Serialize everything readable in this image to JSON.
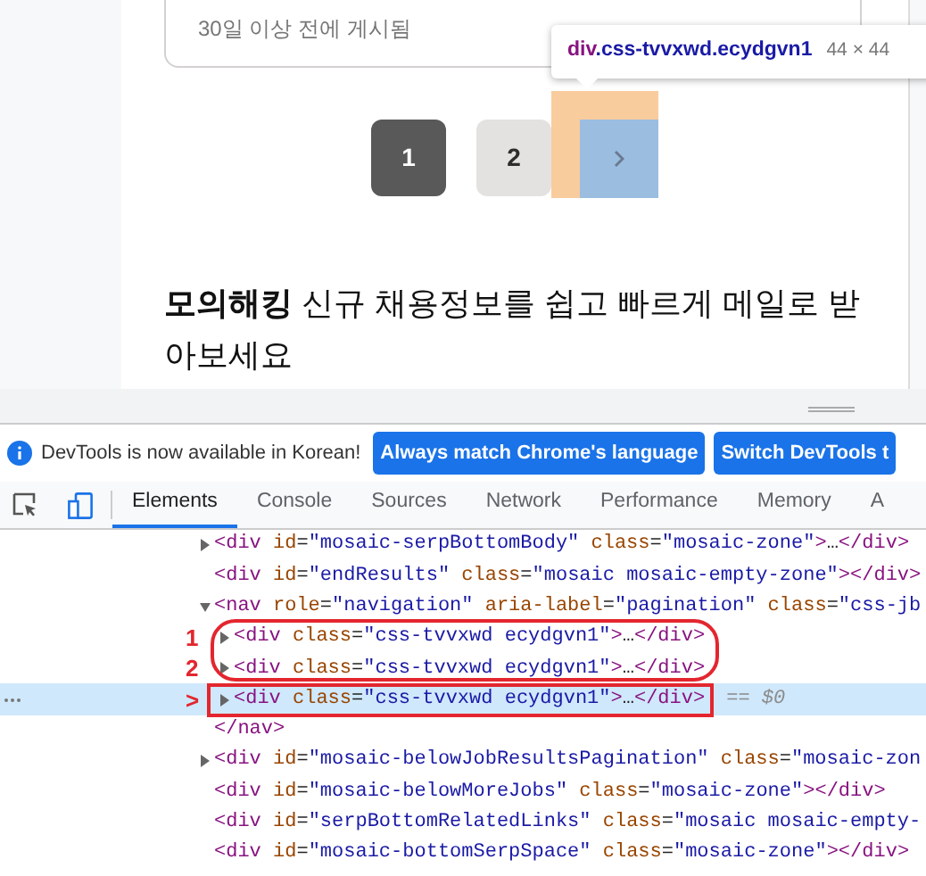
{
  "page": {
    "job_card": {
      "posted": "30일 이상 전에 게시됨"
    },
    "pagination": {
      "pages": [
        {
          "label": "1",
          "selected": true
        },
        {
          "label": "2",
          "selected": false
        }
      ],
      "next_inspected": true
    },
    "inspect_tooltip": {
      "element": "div",
      "classes": ".css-tvvxwd.ecydgvn1",
      "size": "44 × 44"
    },
    "alert_heading": "**모의해킹** 신규 채용정보를 쉽고 빠르게 메일로 받아보세요"
  },
  "devtools": {
    "infobar": {
      "message": "DevTools is now available in Korean!",
      "buttons": [
        "Always match Chrome's language",
        "Switch DevTools t"
      ]
    },
    "tabs": [
      {
        "label": "Elements",
        "selected": true
      },
      {
        "label": "Console",
        "selected": false
      },
      {
        "label": "Sources",
        "selected": false
      },
      {
        "label": "Network",
        "selected": false
      },
      {
        "label": "Performance",
        "selected": false
      },
      {
        "label": "Memory",
        "selected": false
      },
      {
        "label": "A",
        "selected": false
      }
    ],
    "dom_tree": [
      {
        "expanded": false,
        "selected": false,
        "code": "<div id=\"mosaic-serpBottomBody\" class=\"mosaic-zone\">…</div>"
      },
      {
        "selected": false,
        "code": "<div id=\"endResults\" class=\"mosaic mosaic-empty-zone\"></div>"
      },
      {
        "expanded": true,
        "selected": false,
        "code": "<nav role=\"navigation\" aria-label=\"pagination\" class=\"css-jb",
        "children": [
          {
            "expanded": false,
            "selected": false,
            "marker": "1",
            "circled": true,
            "code": "<div class=\"css-tvvxwd ecydgvn1\">…</div>"
          },
          {
            "expanded": false,
            "selected": false,
            "marker": "2",
            "circled": true,
            "code": "<div class=\"css-tvvxwd ecydgvn1\">…</div>"
          },
          {
            "expanded": false,
            "selected": true,
            "marker": ">",
            "boxed": true,
            "code": "<div class=\"css-tvvxwd ecydgvn1\">…</div>",
            "suffix": "== $0"
          }
        ]
      },
      {
        "selected": false,
        "code": "</nav>"
      },
      {
        "expanded": false,
        "selected": false,
        "code": "<div id=\"mosaic-belowJobResultsPagination\" class=\"mosaic-zon"
      },
      {
        "selected": false,
        "code": "<div id=\"mosaic-belowMoreJobs\" class=\"mosaic-zone\"></div>"
      },
      {
        "selected": false,
        "code": "<div id=\"serpBottomRelatedLinks\" class=\"mosaic mosaic-empty-"
      },
      {
        "selected": false,
        "code": "<div id=\"mosaic-bottomSerpSpace\" class=\"mosaic-zone\"></div>"
      }
    ]
  }
}
